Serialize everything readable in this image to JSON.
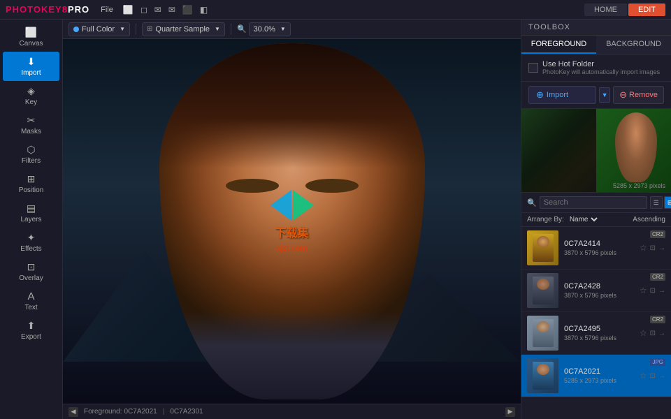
{
  "app": {
    "name": "PHOTOKEY",
    "version": "8PRO",
    "menu": [
      "File"
    ],
    "nav": [
      {
        "label": "HOME",
        "active": false
      },
      {
        "label": "EDIT",
        "active": true
      }
    ]
  },
  "toolbar": {
    "color_mode": "Full Color",
    "sample": "Quarter Sample",
    "zoom": "30.0%"
  },
  "sidebar": {
    "items": [
      {
        "label": "Canvas",
        "icon": "⬜",
        "active": false
      },
      {
        "label": "Import",
        "icon": "⬇",
        "active": true
      },
      {
        "label": "Key",
        "icon": "🔑",
        "active": false
      },
      {
        "label": "Masks",
        "icon": "✂",
        "active": false
      },
      {
        "label": "Filters",
        "icon": "🔶",
        "active": false
      },
      {
        "label": "Position",
        "icon": "⊞",
        "active": false
      },
      {
        "label": "Layers",
        "icon": "▤",
        "active": false
      },
      {
        "label": "Effects",
        "icon": "✦",
        "active": false
      },
      {
        "label": "Overlay",
        "icon": "⊡",
        "active": false
      },
      {
        "label": "Text",
        "icon": "A",
        "active": false
      },
      {
        "label": "Export",
        "icon": "⬆",
        "active": false
      }
    ]
  },
  "panel": {
    "tabs": [
      {
        "label": "FOREGROUND",
        "active": true
      },
      {
        "label": "BACKGROUND",
        "active": false
      }
    ],
    "hot_folder": {
      "checkbox_label": "Use Hot Folder",
      "description": "PhotoKey will automatically import images"
    },
    "import_btn": "Import",
    "remove_btn": "Remove",
    "preview": {
      "dimensions": "5285 x 2973 pixels"
    },
    "search_placeholder": "Search",
    "arrange": {
      "label": "Arrange By:",
      "field": "Name",
      "order": "Ascending"
    },
    "files": [
      {
        "name": "0C7A2414",
        "dims": "3870 x 5796 pixels",
        "badge": "CR2",
        "thumb": "yellow"
      },
      {
        "name": "0C7A2428",
        "dims": "3870 x 5796 pixels",
        "badge": "CR2",
        "thumb": "gray"
      },
      {
        "name": "0C7A2495",
        "dims": "3870 x 5796 pixels",
        "badge": "CR2",
        "thumb": "light"
      },
      {
        "name": "0C7A2021",
        "dims": "5285 x 2973 pixels",
        "badge": "JPG",
        "thumb": "selected",
        "selected": true
      }
    ]
  },
  "statusbar": {
    "foreground_label": "Foreground:",
    "foreground_value": "0C7A2021",
    "background_label": "0C7A2301"
  },
  "watermark": {
    "text": "下载集",
    "sub": "xjzt.com"
  }
}
